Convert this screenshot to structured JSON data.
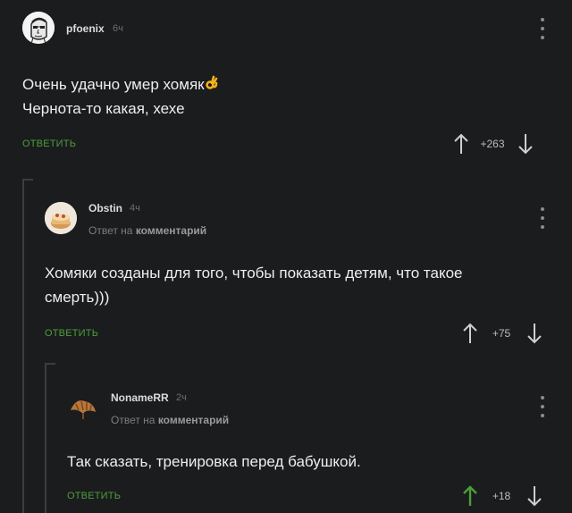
{
  "comments": [
    {
      "author": "pfoenix",
      "time": "6ч",
      "reply_note": "",
      "lines": [
        "Очень удачно умер хомяк",
        "Чернота-то какая, хехе"
      ],
      "reply_label": "ОТВЕТИТЬ",
      "score": "+263"
    },
    {
      "author": "Obstin",
      "time": "4ч",
      "reply_note_prefix": "Ответ на",
      "reply_note_link": "комментарий",
      "lines": [
        "Хомяки созданы для того, чтобы показать детям, что такое",
        "смерть)))"
      ],
      "reply_label": "ОТВЕТИТЬ",
      "score": "+75"
    },
    {
      "author": "NonameRR",
      "time": "2ч",
      "reply_note_prefix": "Ответ на",
      "reply_note_link": "комментарий",
      "lines": [
        "Так сказать, тренировка перед бабушкой."
      ],
      "reply_label": "ОТВЕТИТЬ",
      "score": "+18"
    }
  ],
  "colors": {
    "background": "#1b1c1e",
    "reply_green": "#4b9f39",
    "upvote_active": "#4b9f39"
  },
  "icons": [
    "kebab-menu-icon",
    "upvote-arrow-icon",
    "downvote-arrow-icon",
    "ok-hand-emoji-icon"
  ]
}
